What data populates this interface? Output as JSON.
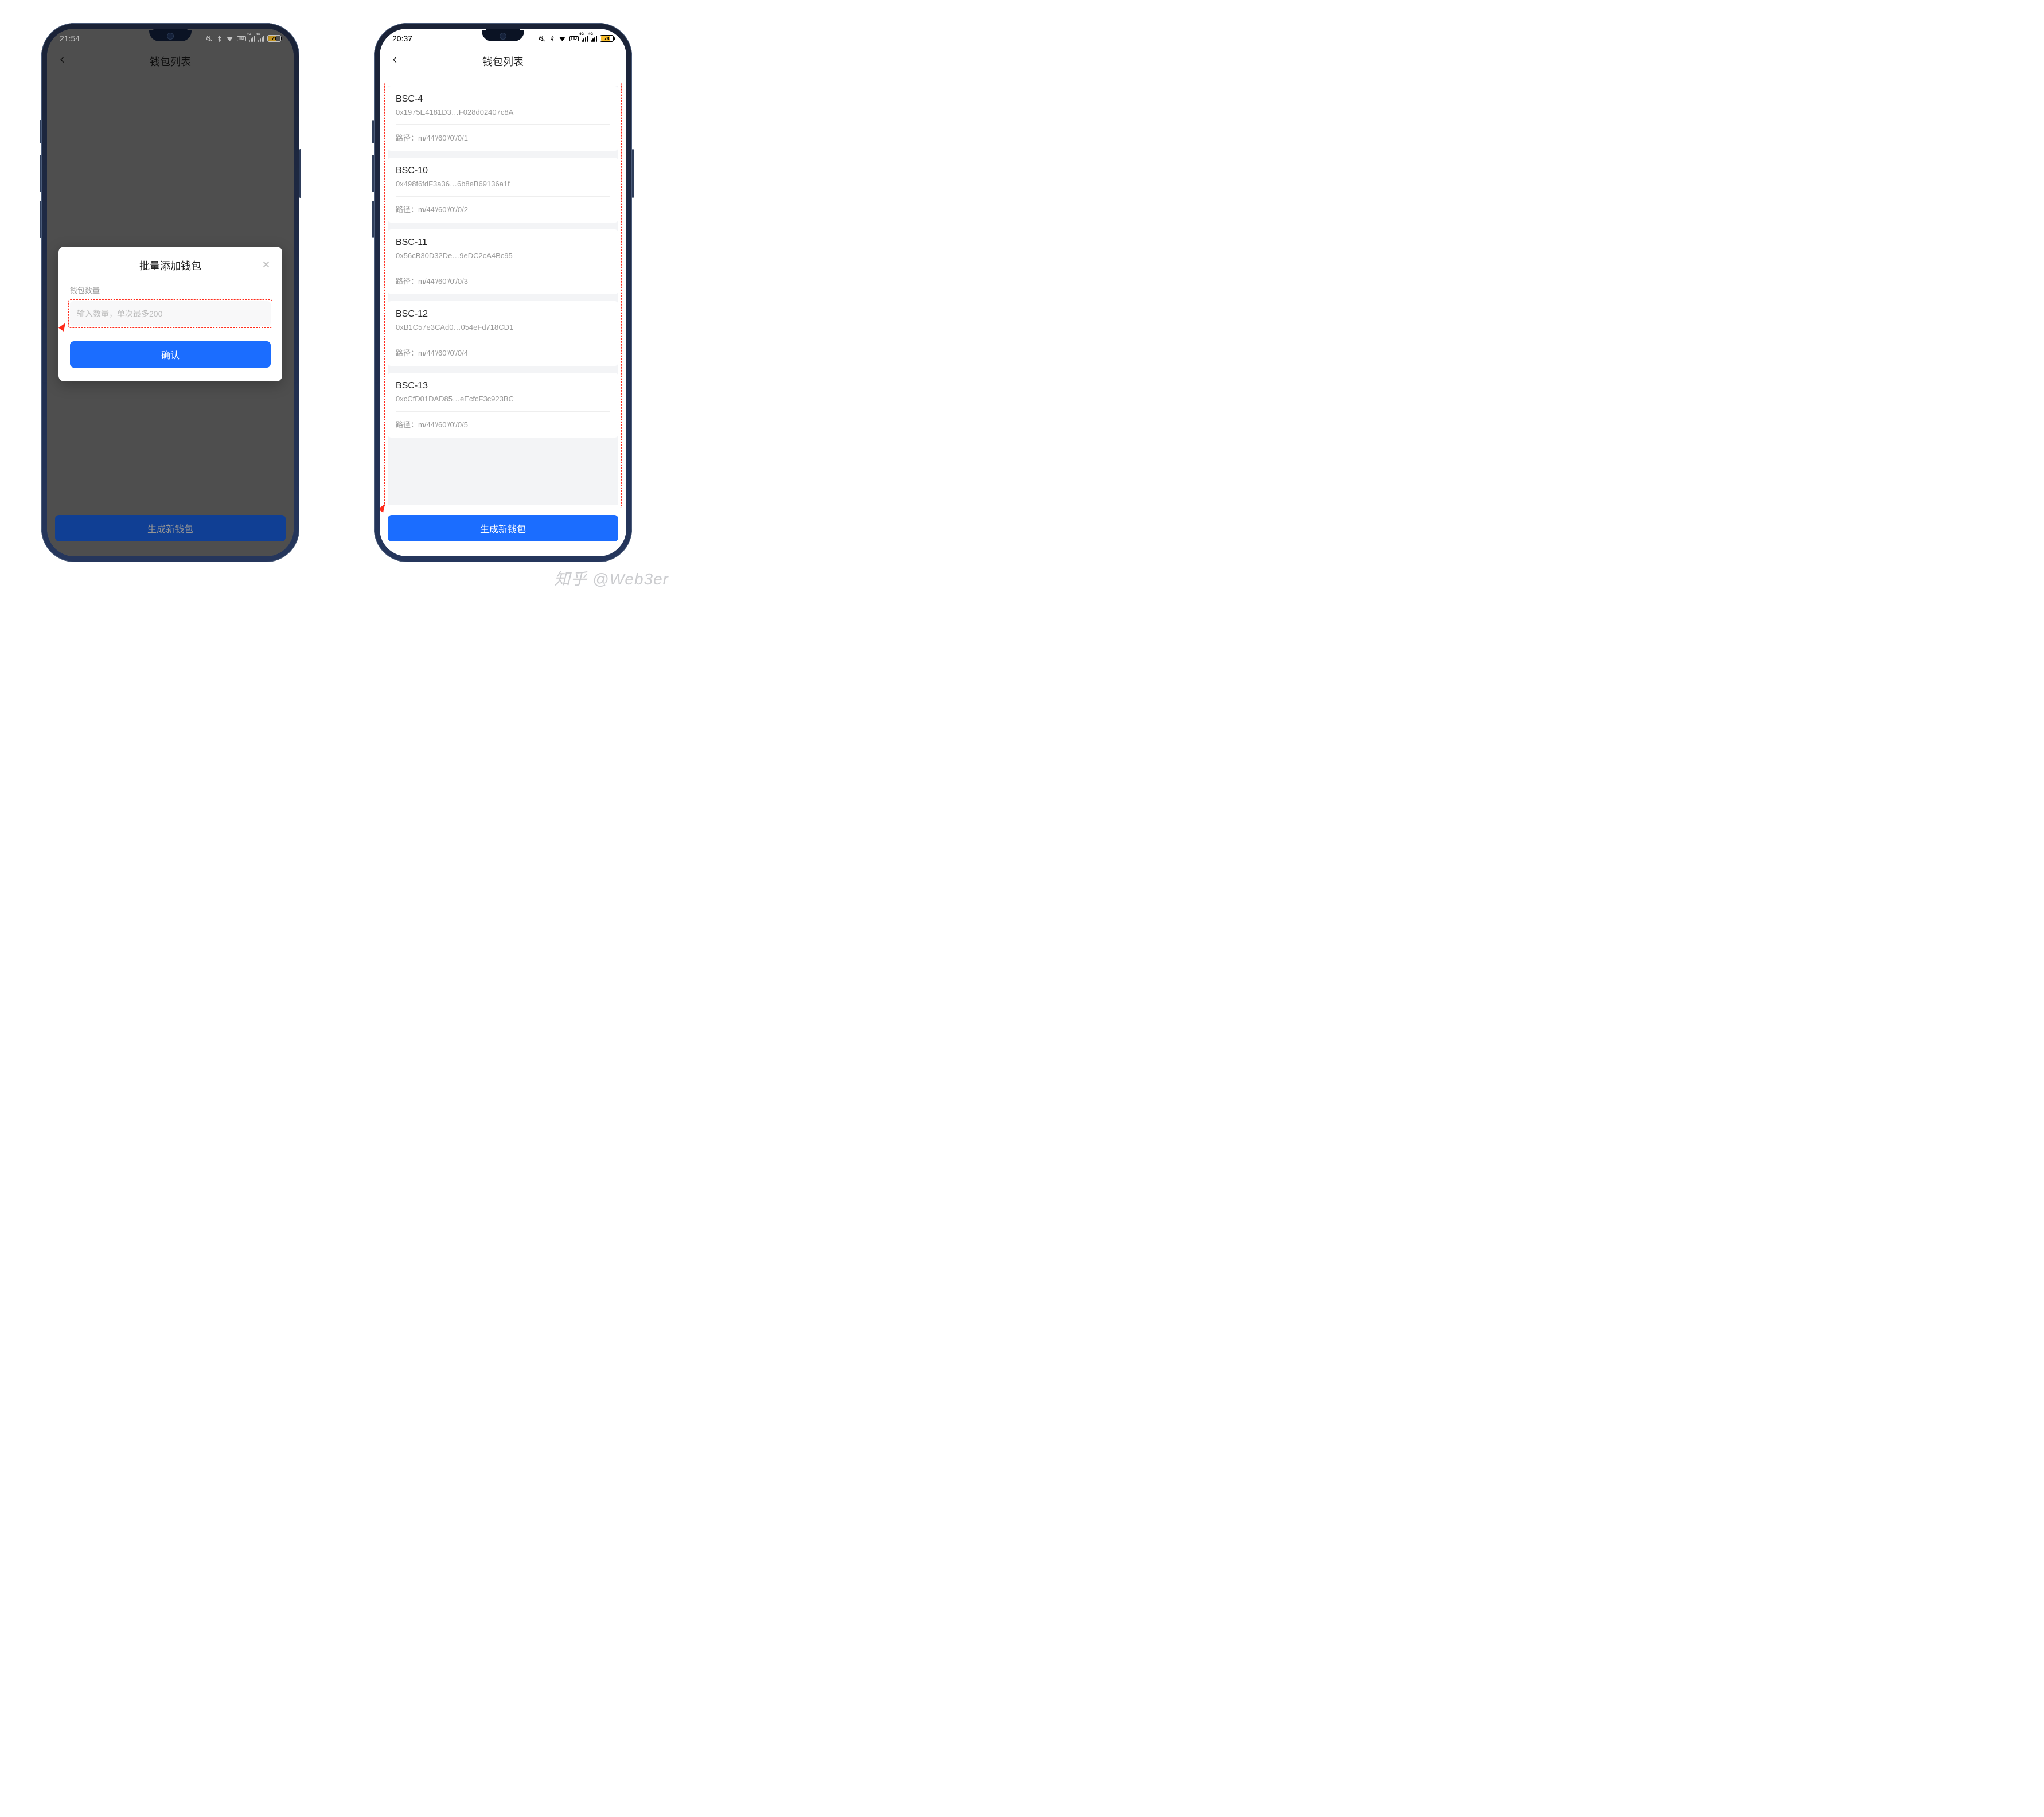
{
  "left": {
    "status": {
      "time": "21:54",
      "battery_pct": "71",
      "battery_fill": "71%"
    },
    "nav_title": "钱包列表",
    "modal": {
      "title": "批量添加钱包",
      "qty_label": "钱包数量",
      "placeholder": "输入数量，单次最多200",
      "confirm": "确认"
    },
    "bottom_btn": "生成新钱包"
  },
  "right": {
    "status": {
      "time": "20:37",
      "battery_pct": "78",
      "battery_fill": "78%"
    },
    "nav_title": "钱包列表",
    "path_prefix": "路径：",
    "wallets": [
      {
        "name": "BSC-4",
        "addr": "0x1975E4181D3…F028d02407c8A",
        "path": "m/44'/60'/0'/0/1"
      },
      {
        "name": "BSC-10",
        "addr": "0x498f6fdF3a36…6b8eB69136a1f",
        "path": "m/44'/60'/0'/0/2"
      },
      {
        "name": "BSC-11",
        "addr": "0x56cB30D32De…9eDC2cA4Bc95",
        "path": "m/44'/60'/0'/0/3"
      },
      {
        "name": "BSC-12",
        "addr": "0xB1C57e3CAd0…054eFd718CD1",
        "path": "m/44'/60'/0'/0/4"
      },
      {
        "name": "BSC-13",
        "addr": "0xcCfD01DAD85…eEcfcF3c923BC",
        "path": "m/44'/60'/0'/0/5"
      }
    ],
    "bottom_btn": "生成新钱包"
  },
  "watermark": "知乎 @Web3er"
}
